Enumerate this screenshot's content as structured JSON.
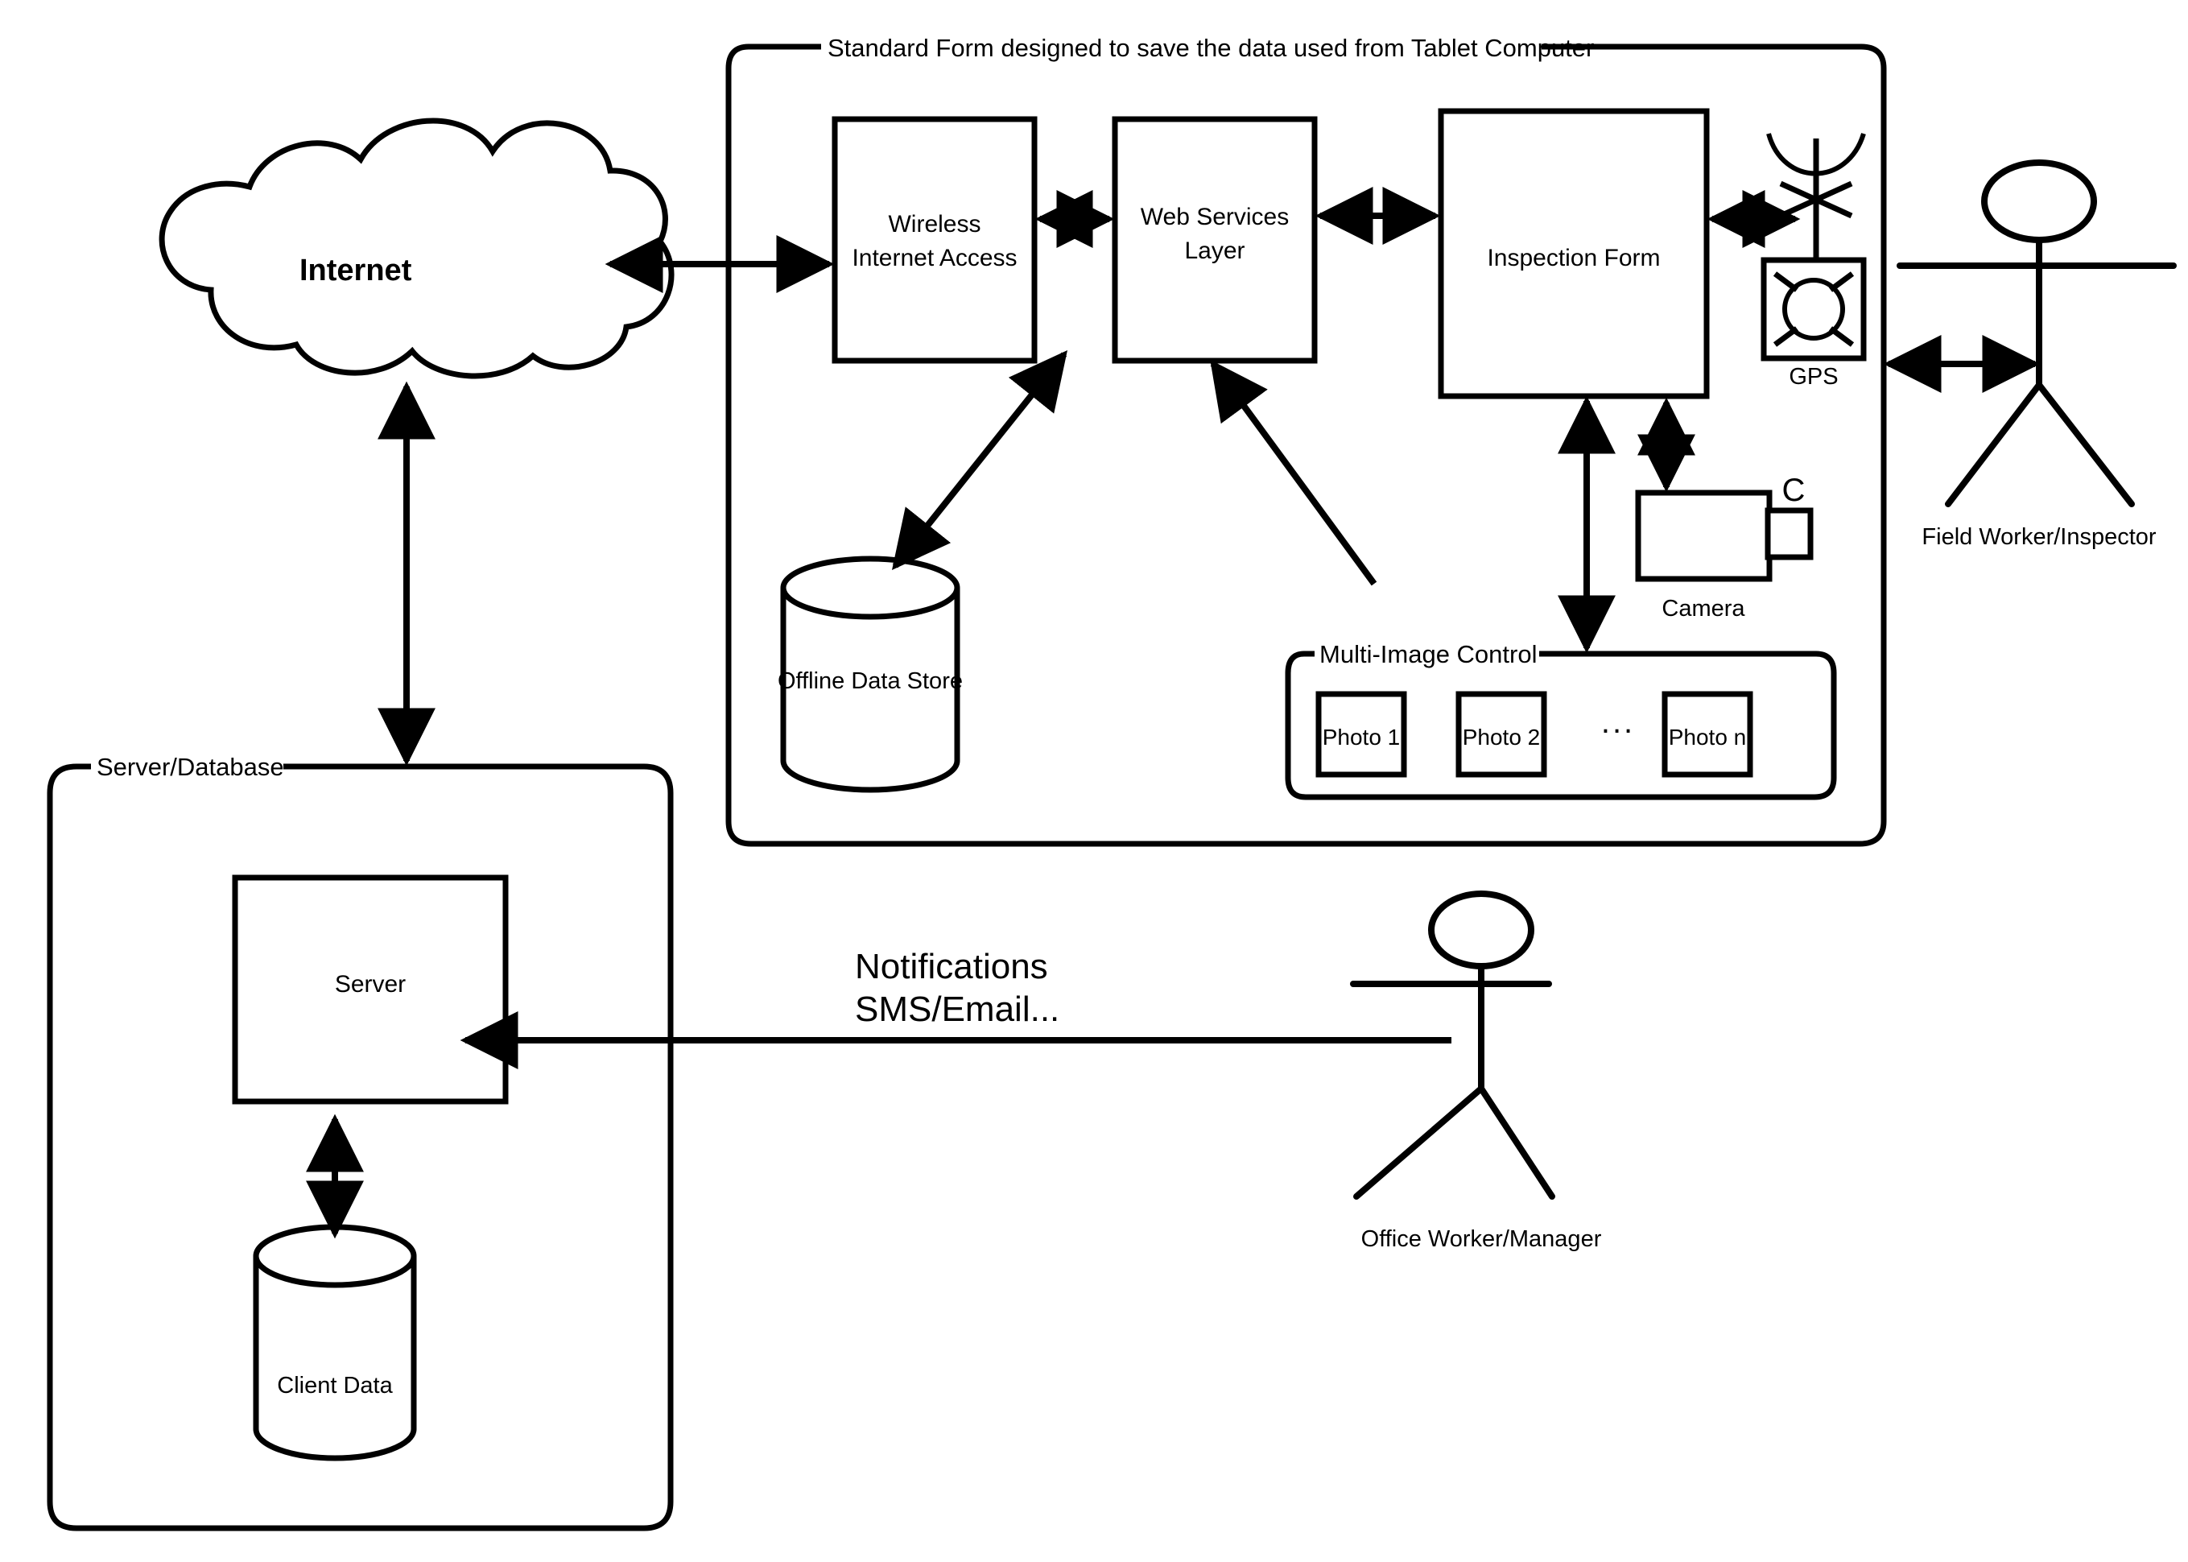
{
  "diagram": {
    "title_label": "Standard Form designed to save the data used from Tablet Computer",
    "server_group_label": "Server/Database",
    "multi_image_group_label": "Multi-Image Control",
    "cloud_label": "Internet",
    "boxes": {
      "wireless": "Wireless\nInternet Access",
      "wireless_line1": "Wireless",
      "wireless_line2": "Internet Access",
      "web_services_line1": "Web Services",
      "web_services_line2": "Layer",
      "inspection_form": "Inspection Form",
      "server": "Server"
    },
    "cylinders": {
      "offline_data_store": "Offline Data Store",
      "client_data": "Client Data"
    },
    "devices": {
      "gps_label": "GPS",
      "camera_label": "Camera",
      "camera_badge": "C"
    },
    "photos": [
      {
        "label": "Photo 1"
      },
      {
        "label": "Photo 2"
      },
      {
        "label": "Photo n"
      }
    ],
    "photos_ellipsis": "...",
    "actors": [
      {
        "label": "Field Worker/Inspector"
      },
      {
        "label": "Office Worker/Manager"
      }
    ],
    "notification": {
      "line1": "Notifications",
      "line2": "SMS/Email..."
    },
    "colors": {
      "stroke": "#000000",
      "fill": "#ffffff",
      "background": "#ffffff"
    },
    "icons": {
      "gps": "gps-antenna-icon",
      "camera": "camera-icon",
      "cloud": "cloud-icon",
      "database": "database-cylinder-icon",
      "actor": "stick-figure-actor-icon"
    }
  }
}
